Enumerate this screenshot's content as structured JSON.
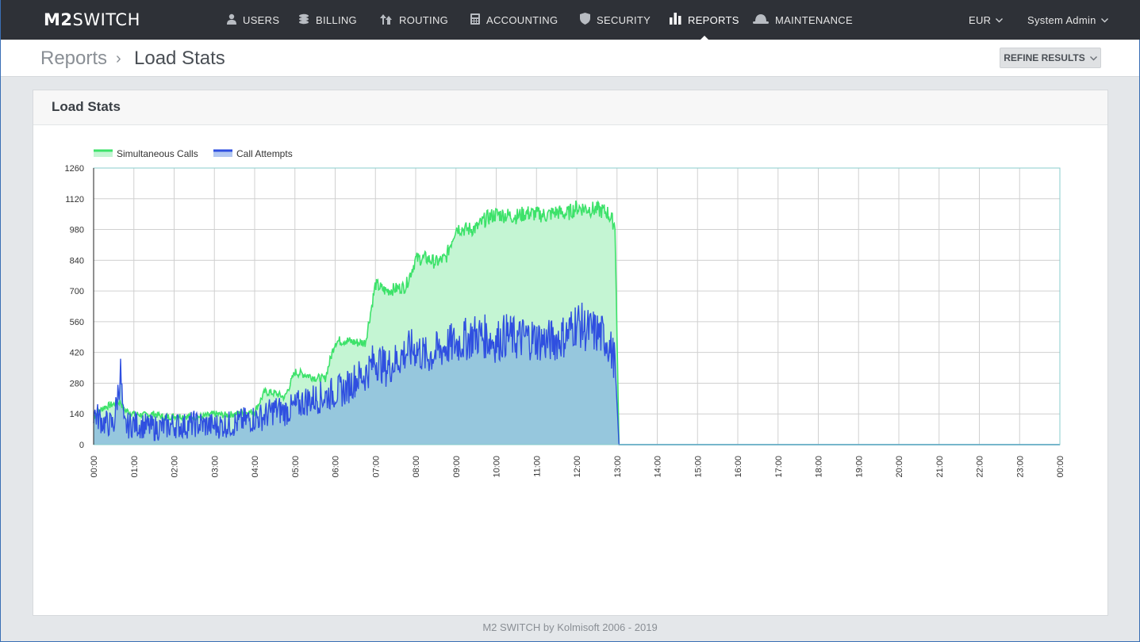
{
  "app": {
    "logo_bold": "M2",
    "logo_light": "SWITCH"
  },
  "nav": {
    "items": [
      {
        "label": "USERS",
        "icon": "user-icon"
      },
      {
        "label": "BILLING",
        "icon": "coins-icon"
      },
      {
        "label": "ROUTING",
        "icon": "routing-arrows-icon"
      },
      {
        "label": "ACCOUNTING",
        "icon": "calculator-icon"
      },
      {
        "label": "SECURITY",
        "icon": "shield-icon"
      },
      {
        "label": "REPORTS",
        "icon": "bar-chart-icon",
        "active": true
      },
      {
        "label": "MAINTENANCE",
        "icon": "hard-hat-icon"
      }
    ],
    "currency": "EUR",
    "user": "System Admin"
  },
  "breadcrumb": {
    "parent": "Reports",
    "separator": "›",
    "current": "Load Stats"
  },
  "toolbar": {
    "refine_label": "REFINE RESULTS"
  },
  "panel": {
    "title": "Load Stats"
  },
  "footer": {
    "text": "M2 SWITCH by Kolmisoft 2006 - 2019"
  },
  "colors": {
    "nav_bg": "#2e3137",
    "simultaneous_line": "#3de26a",
    "simultaneous_fill": "#c4f5d3",
    "attempts_line": "#2f4fe0",
    "attempts_fill": "#93c4dd",
    "plot_border": "#88cccc"
  },
  "chart_data": {
    "type": "area",
    "title": "",
    "xlabel": "",
    "ylabel": "",
    "ylim": [
      0,
      1260
    ],
    "yticks": [
      0,
      140,
      280,
      420,
      560,
      700,
      840,
      980,
      1120,
      1260
    ],
    "xlim": [
      "00:00",
      "24:00"
    ],
    "xticks": [
      "00:00",
      "01:00",
      "02:00",
      "03:00",
      "04:00",
      "05:00",
      "06:00",
      "07:00",
      "08:00",
      "09:00",
      "10:00",
      "11:00",
      "12:00",
      "13:00",
      "14:00",
      "15:00",
      "16:00",
      "17:00",
      "18:00",
      "19:00",
      "20:00",
      "21:00",
      "22:00",
      "23:00",
      "00:00"
    ],
    "grid": true,
    "legend_position": "top-left",
    "x_hours": [
      0,
      0.25,
      0.5,
      0.67,
      0.75,
      1,
      1.25,
      1.5,
      1.75,
      2,
      2.25,
      2.5,
      2.75,
      3,
      3.25,
      3.5,
      3.75,
      4,
      4.25,
      4.5,
      4.75,
      5,
      5.25,
      5.5,
      5.75,
      6,
      6.25,
      6.5,
      6.75,
      7,
      7.25,
      7.5,
      7.75,
      8,
      8.25,
      8.5,
      8.75,
      9,
      9.25,
      9.5,
      9.75,
      10,
      10.25,
      10.5,
      10.75,
      11,
      11.25,
      11.5,
      11.75,
      12,
      12.25,
      12.5,
      12.75,
      12.95,
      13.05,
      14,
      24
    ],
    "series": [
      {
        "name": "Simultaneous Calls",
        "values": [
          130,
          170,
          185,
          195,
          160,
          140,
          135,
          140,
          125,
          130,
          130,
          125,
          130,
          140,
          135,
          140,
          145,
          150,
          240,
          235,
          215,
          330,
          320,
          305,
          300,
          470,
          475,
          465,
          465,
          730,
          700,
          710,
          720,
          845,
          850,
          830,
          850,
          990,
          980,
          985,
          1030,
          1050,
          1045,
          1040,
          1055,
          1050,
          1045,
          1060,
          1050,
          1080,
          1075,
          1070,
          1060,
          1000,
          0,
          0,
          0
        ]
      },
      {
        "name": "Call Attempts",
        "values": [
          145,
          100,
          90,
          330,
          80,
          95,
          85,
          75,
          80,
          90,
          85,
          95,
          90,
          85,
          90,
          95,
          110,
          120,
          130,
          160,
          150,
          170,
          200,
          210,
          220,
          240,
          250,
          300,
          320,
          390,
          350,
          380,
          420,
          440,
          400,
          420,
          450,
          460,
          480,
          500,
          490,
          470,
          500,
          480,
          490,
          480,
          470,
          480,
          500,
          560,
          520,
          510,
          480,
          380,
          0,
          0,
          0
        ]
      }
    ]
  }
}
